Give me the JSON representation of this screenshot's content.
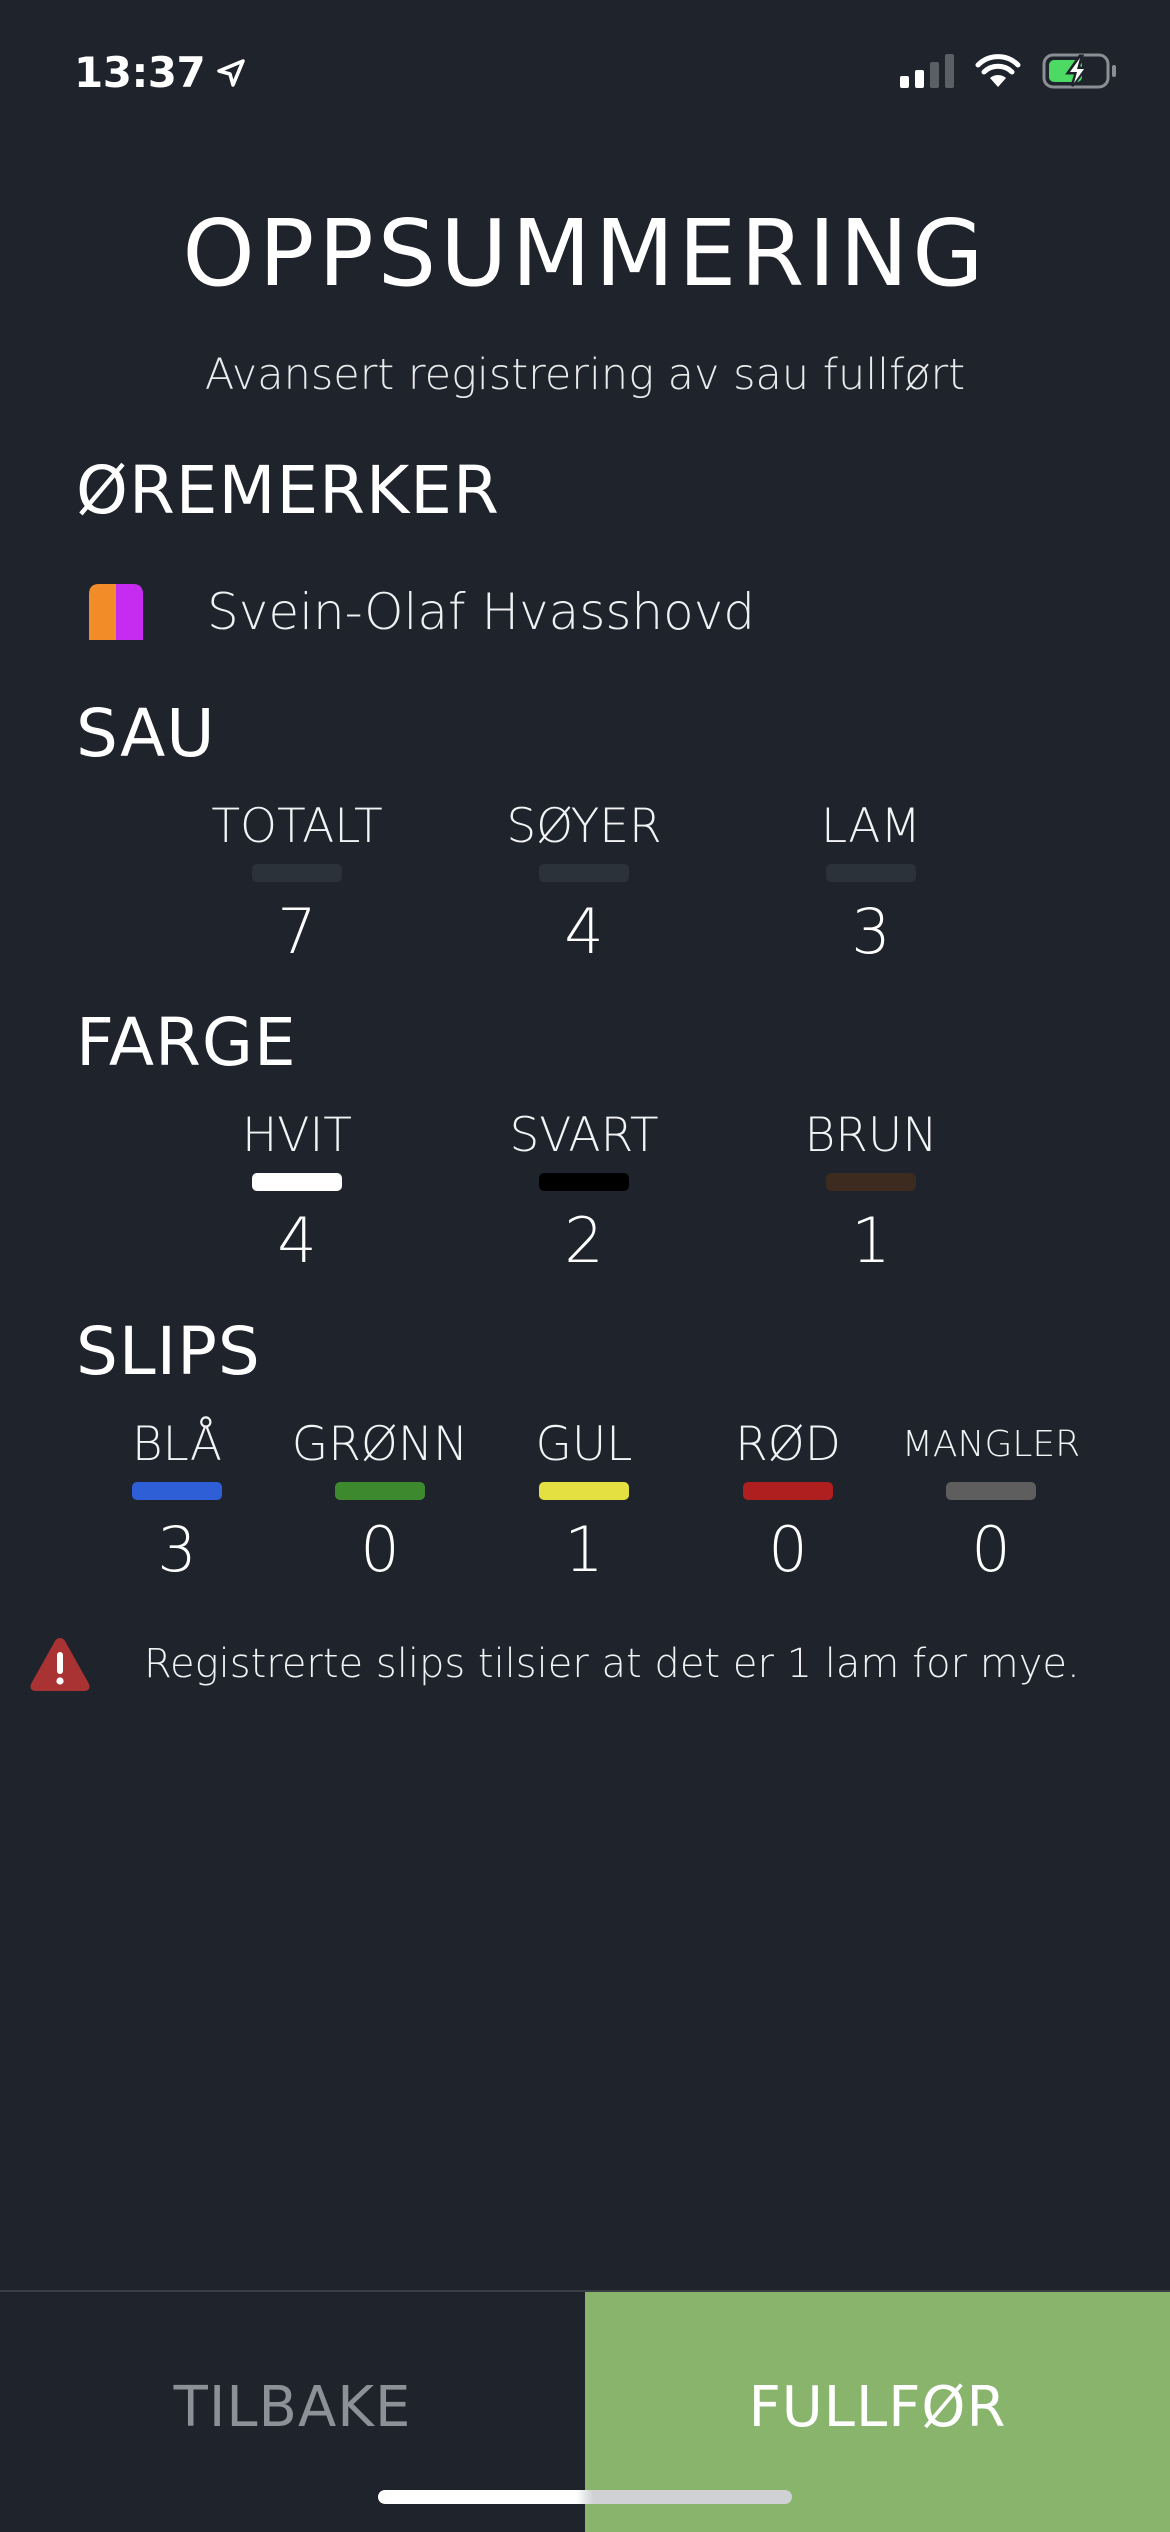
{
  "status_bar": {
    "time": "13:37"
  },
  "header": {
    "title": "OPPSUMMERING",
    "subtitle": "Avansert registrering av sau fullført"
  },
  "eartags": {
    "heading": "ØREMERKER",
    "owner": "Svein-Olaf Hvasshovd",
    "colors": [
      "#f28c28",
      "#c62cf0"
    ]
  },
  "sheep": {
    "heading": "SAU",
    "stats": [
      {
        "label": "TOTALT",
        "value": "7",
        "color": "#2c323a"
      },
      {
        "label": "SØYER",
        "value": "4",
        "color": "#2c323a"
      },
      {
        "label": "LAM",
        "value": "3",
        "color": "#2c323a"
      }
    ]
  },
  "color": {
    "heading": "FARGE",
    "stats": [
      {
        "label": "HVIT",
        "value": "4",
        "color": "#ffffff"
      },
      {
        "label": "SVART",
        "value": "2",
        "color": "#000000"
      },
      {
        "label": "BRUN",
        "value": "1",
        "color": "#3d2b1f"
      }
    ]
  },
  "ties": {
    "heading": "SLIPS",
    "stats": [
      {
        "label": "BLÅ",
        "value": "3",
        "color": "#2f5fd6"
      },
      {
        "label": "GRØNN",
        "value": "0",
        "color": "#3d8a2e"
      },
      {
        "label": "GUL",
        "value": "1",
        "color": "#e4e042"
      },
      {
        "label": "RØD",
        "value": "0",
        "color": "#b01f1f"
      },
      {
        "label": "MANGLER",
        "value": "0",
        "color": "#5e5e5e"
      }
    ]
  },
  "warning": {
    "text": "Registrerte slips tilsier at det er 1 lam for mye.",
    "icon": "warning-triangle-icon",
    "color": "#d33a3a"
  },
  "buttons": {
    "back": "TILBAKE",
    "finish": "FULLFØR"
  }
}
